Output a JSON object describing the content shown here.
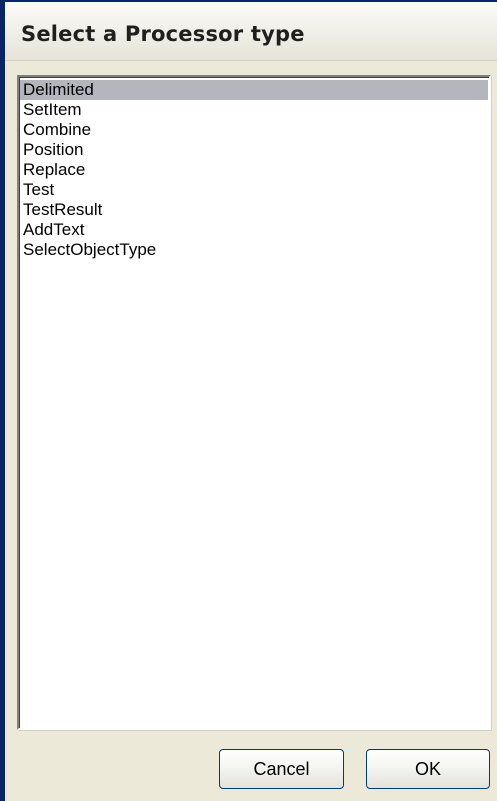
{
  "window": {
    "title": "Select a Processor type"
  },
  "list": {
    "selected_index": 0,
    "items": [
      "Delimited",
      "SetItem",
      "Combine",
      "Position",
      "Replace",
      "Test",
      "TestResult",
      "AddText",
      "SelectObjectType"
    ]
  },
  "buttons": {
    "cancel_label": "Cancel",
    "ok_label": "OK"
  },
  "colors": {
    "window_background": "#ece9d8",
    "selection": "#b5b5bd",
    "frame_accent": "#0a246a",
    "button_border": "#003c74"
  }
}
